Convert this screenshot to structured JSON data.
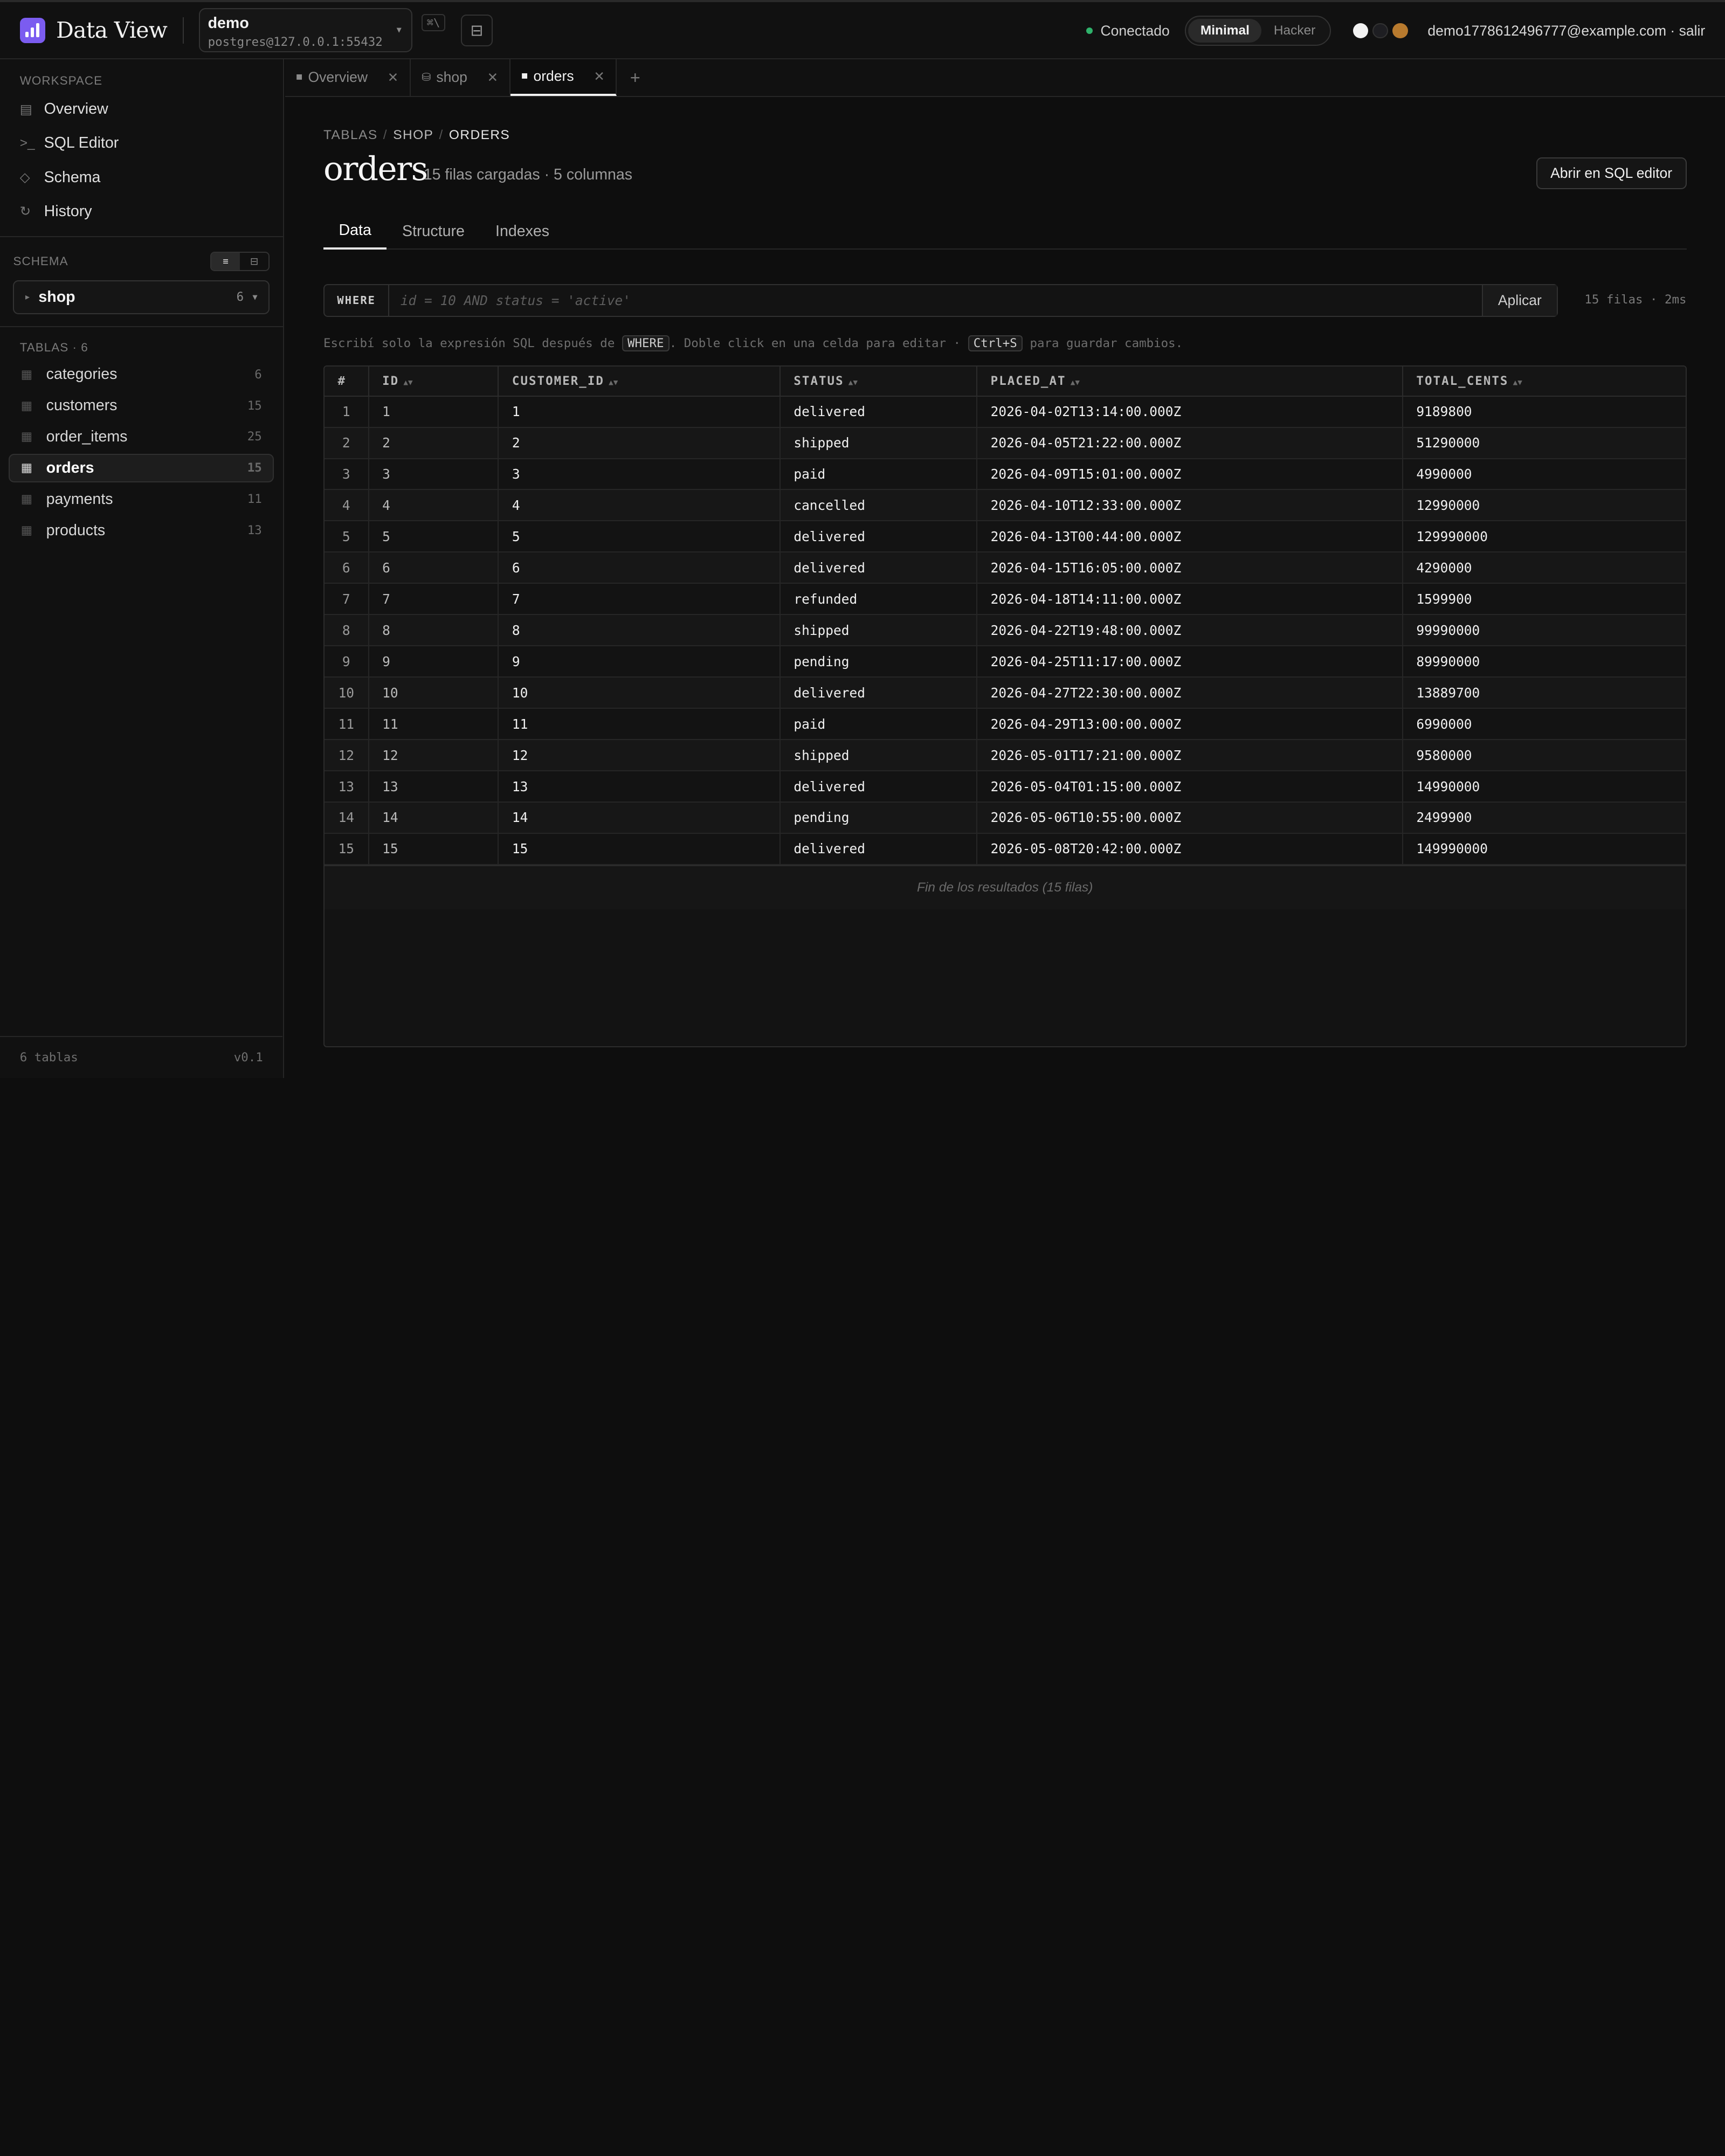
{
  "app": {
    "name": "Data View",
    "connection": {
      "name": "demo",
      "host": "postgres@127.0.0.1:55432"
    },
    "shortcut_hint": "⌘\\",
    "status": "Conectado",
    "modes": [
      "Minimal",
      "Hacker"
    ],
    "active_mode": "Minimal",
    "theme_swatches": [
      "#f2f2f2",
      "#1e1e22",
      "#b87a2e"
    ],
    "user": "demo1778612496777@example.com · salir"
  },
  "sidebar": {
    "workspace_title": "WORKSPACE",
    "nav": [
      {
        "label": "Overview",
        "icon": "▤"
      },
      {
        "label": "SQL Editor",
        "icon": ">_"
      },
      {
        "label": "Schema",
        "icon": "◇"
      },
      {
        "label": "History",
        "icon": "↻"
      }
    ],
    "schema_title": "SCHEMA",
    "schema": {
      "name": "shop",
      "count": "6"
    },
    "tables_title": "TABLAS · 6",
    "tables": [
      {
        "name": "categories",
        "count": "6"
      },
      {
        "name": "customers",
        "count": "15"
      },
      {
        "name": "order_items",
        "count": "25"
      },
      {
        "name": "orders",
        "count": "15"
      },
      {
        "name": "payments",
        "count": "11"
      },
      {
        "name": "products",
        "count": "13"
      }
    ],
    "footer_left": "6 tablas",
    "footer_right": "v0.1"
  },
  "tabs": [
    {
      "label": "Overview",
      "icon": "■"
    },
    {
      "label": "shop",
      "icon": "⛁"
    },
    {
      "label": "orders",
      "icon": "■"
    }
  ],
  "main": {
    "breadcrumb": [
      "TABLAS",
      "SHOP",
      "ORDERS"
    ],
    "title": "orders",
    "subtitle": "15 filas cargadas · 5 columnas",
    "open_sql_label": "Abrir en SQL editor",
    "subtabs": [
      "Data",
      "Structure",
      "Indexes"
    ],
    "filter": {
      "label": "WHERE",
      "placeholder": "id = 10 AND status = 'active'",
      "apply_label": "Aplicar",
      "row_info": "15 filas · 2ms"
    },
    "hint": {
      "pre": "Escribí solo la expresión SQL después de ",
      "kbd1": "WHERE",
      "mid": ". Doble click en una celda para editar · ",
      "kbd2": "Ctrl+S",
      "post": " para guardar cambios."
    },
    "table": {
      "columns": [
        "#",
        "ID",
        "CUSTOMER_ID",
        "STATUS",
        "PLACED_AT",
        "TOTAL_CENTS"
      ],
      "rows": [
        [
          "1",
          "1",
          "1",
          "delivered",
          "2026-04-02T13:14:00.000Z",
          "9189800"
        ],
        [
          "2",
          "2",
          "2",
          "shipped",
          "2026-04-05T21:22:00.000Z",
          "51290000"
        ],
        [
          "3",
          "3",
          "3",
          "paid",
          "2026-04-09T15:01:00.000Z",
          "4990000"
        ],
        [
          "4",
          "4",
          "4",
          "cancelled",
          "2026-04-10T12:33:00.000Z",
          "12990000"
        ],
        [
          "5",
          "5",
          "5",
          "delivered",
          "2026-04-13T00:44:00.000Z",
          "129990000"
        ],
        [
          "6",
          "6",
          "6",
          "delivered",
          "2026-04-15T16:05:00.000Z",
          "4290000"
        ],
        [
          "7",
          "7",
          "7",
          "refunded",
          "2026-04-18T14:11:00.000Z",
          "1599900"
        ],
        [
          "8",
          "8",
          "8",
          "shipped",
          "2026-04-22T19:48:00.000Z",
          "99990000"
        ],
        [
          "9",
          "9",
          "9",
          "pending",
          "2026-04-25T11:17:00.000Z",
          "89990000"
        ],
        [
          "10",
          "10",
          "10",
          "delivered",
          "2026-04-27T22:30:00.000Z",
          "13889700"
        ],
        [
          "11",
          "11",
          "11",
          "paid",
          "2026-04-29T13:00:00.000Z",
          "6990000"
        ],
        [
          "12",
          "12",
          "12",
          "shipped",
          "2026-05-01T17:21:00.000Z",
          "9580000"
        ],
        [
          "13",
          "13",
          "13",
          "delivered",
          "2026-05-04T01:15:00.000Z",
          "14990000"
        ],
        [
          "14",
          "14",
          "14",
          "pending",
          "2026-05-06T10:55:00.000Z",
          "2499900"
        ],
        [
          "15",
          "15",
          "15",
          "delivered",
          "2026-05-08T20:42:00.000Z",
          "149990000"
        ]
      ],
      "end_note": "Fin de los resultados (15 filas)"
    }
  }
}
